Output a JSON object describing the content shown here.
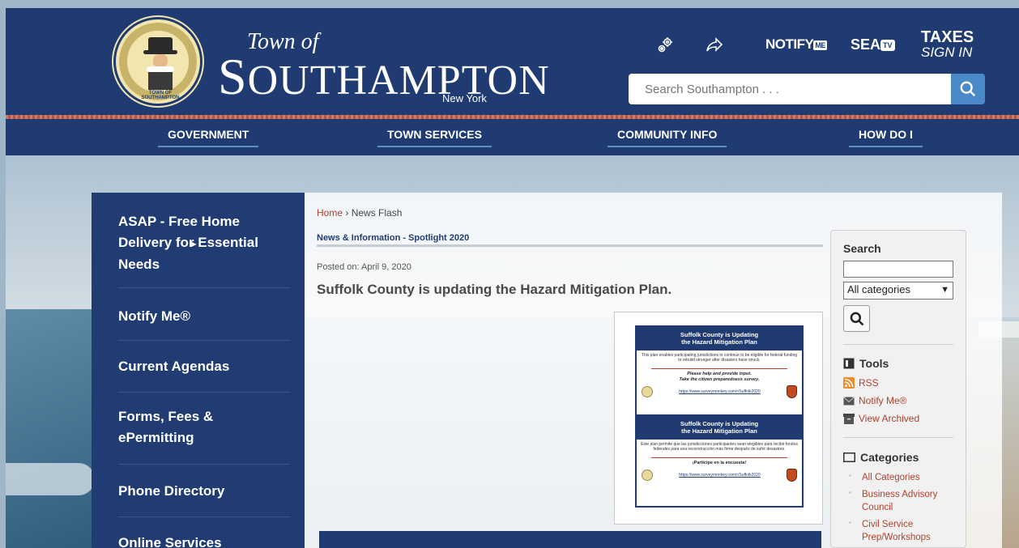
{
  "header": {
    "logo_small": "Town of",
    "logo_big_s": "S",
    "logo_rest": "OUTHAMPTON",
    "logo_sub": "New York",
    "seal_text": "TOWN OF SOUTHAMPTON",
    "notify_label": "NOTIFY",
    "notify_badge": "ME",
    "sea_label": "SEA",
    "tv_badge": "TV",
    "taxes_top": "TAXES",
    "taxes_bottom": "SIGN IN",
    "search_placeholder": "Search Southampton . . ."
  },
  "nav": {
    "items": [
      {
        "label": "GOVERNMENT"
      },
      {
        "label": "TOWN SERVICES"
      },
      {
        "label": "COMMUNITY INFO"
      },
      {
        "label": "HOW DO I"
      }
    ]
  },
  "sidebar": {
    "items": [
      {
        "label": "ASAP - Free Home Delivery for Essential Needs"
      },
      {
        "label": "Notify Me®"
      },
      {
        "label": "Current Agendas"
      },
      {
        "label": "Forms, Fees & ePermitting"
      },
      {
        "label": "Phone Directory"
      },
      {
        "label": "Online Services"
      }
    ],
    "arrow": "►"
  },
  "content": {
    "breadcrumb_home": "Home",
    "breadcrumb_sep": " › ",
    "breadcrumb_current": "News Flash",
    "section_title": "News & Information - Spotlight 2020",
    "posted": "Posted on: April 9, 2020",
    "article_title": "Suffolk County is updating the Hazard Mitigation Plan.",
    "flyer": {
      "en_head_1": "Suffolk County is Updating",
      "en_head_2": "the Hazard Mitigation Plan",
      "en_body": "This plan enables participating jurisdictions to continue to be eligible for federal funding to rebuild stronger after disasters have struck.",
      "en_cta_1": "Please help and provide input.",
      "en_cta_2": "Take the citizen preparedness survey.",
      "link": "https://www.surveymonkey.com/r/Suffolk2020",
      "es_head_1": "Suffolk County is Updating",
      "es_head_2": "the Hazard Mitigation Plan",
      "es_body": "Este plan permite que las jurisdicciones participantes sean elegibles para recibir fondos federales para una reconstrucción más firme después de sufrir desastres.",
      "es_cta": "¡Participe en la encuesta!"
    }
  },
  "right_panel": {
    "search_label": "Search",
    "select_value": "All categories",
    "tools_label": "Tools",
    "rss": "RSS",
    "notify": "Notify Me®",
    "archived": "View Archived",
    "categories_label": "Categories",
    "categories": [
      {
        "label": "All Categories"
      },
      {
        "label": "Business Advisory Council"
      },
      {
        "label": "Civil Service Prep/Workshops"
      }
    ]
  },
  "colors": {
    "navy": "#1f3b72",
    "accent_red": "#b1402c",
    "search_blue": "#4a8ac9"
  }
}
